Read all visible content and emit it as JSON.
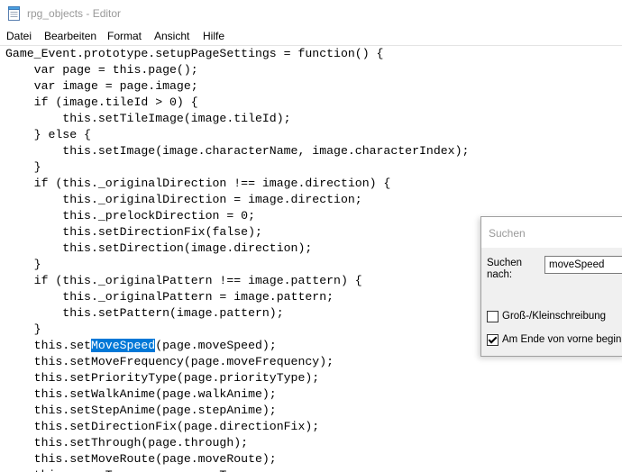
{
  "window": {
    "title": "rpg_objects - Editor"
  },
  "menu": [
    "Datei",
    "Bearbeiten",
    "Format",
    "Ansicht",
    "Hilfe"
  ],
  "editor": {
    "selected_text": "MoveSpeed",
    "lines": [
      "Game_Event.prototype.setupPageSettings = function() {",
      "    var page = this.page();",
      "    var image = page.image;",
      "    if (image.tileId > 0) {",
      "        this.setTileImage(image.tileId);",
      "    } else {",
      "        this.setImage(image.characterName, image.characterIndex);",
      "    }",
      "    if (this._originalDirection !== image.direction) {",
      "        this._originalDirection = image.direction;",
      "        this._prelockDirection = 0;",
      "        this.setDirectionFix(false);",
      "        this.setDirection(image.direction);",
      "    }",
      "    if (this._originalPattern !== image.pattern) {",
      "        this._originalPattern = image.pattern;",
      "        this.setPattern(image.pattern);",
      "    }",
      "    this.setMoveSpeed(page.moveSpeed);",
      "    this.setMoveFrequency(page.moveFrequency);",
      "    this.setPriorityType(page.priorityType);",
      "    this.setWalkAnime(page.walkAnime);",
      "    this.setStepAnime(page.stepAnime);",
      "    this.setDirectionFix(page.directionFix);",
      "    this.setThrough(page.through);",
      "    this.setMoveRoute(page.moveRoute);",
      "    this._moveType = page.moveType;"
    ]
  },
  "find_dialog": {
    "title": "Suchen",
    "search_label": "Suchen nach:",
    "search_value": "moveSpeed",
    "match_case_label": "Groß-/Kleinschreibung",
    "match_case_checked": false,
    "wrap_label": "Am Ende von vorne beginnen",
    "wrap_checked": true
  },
  "colors": {
    "selection": "#0078d7",
    "title_text": "#999999"
  }
}
